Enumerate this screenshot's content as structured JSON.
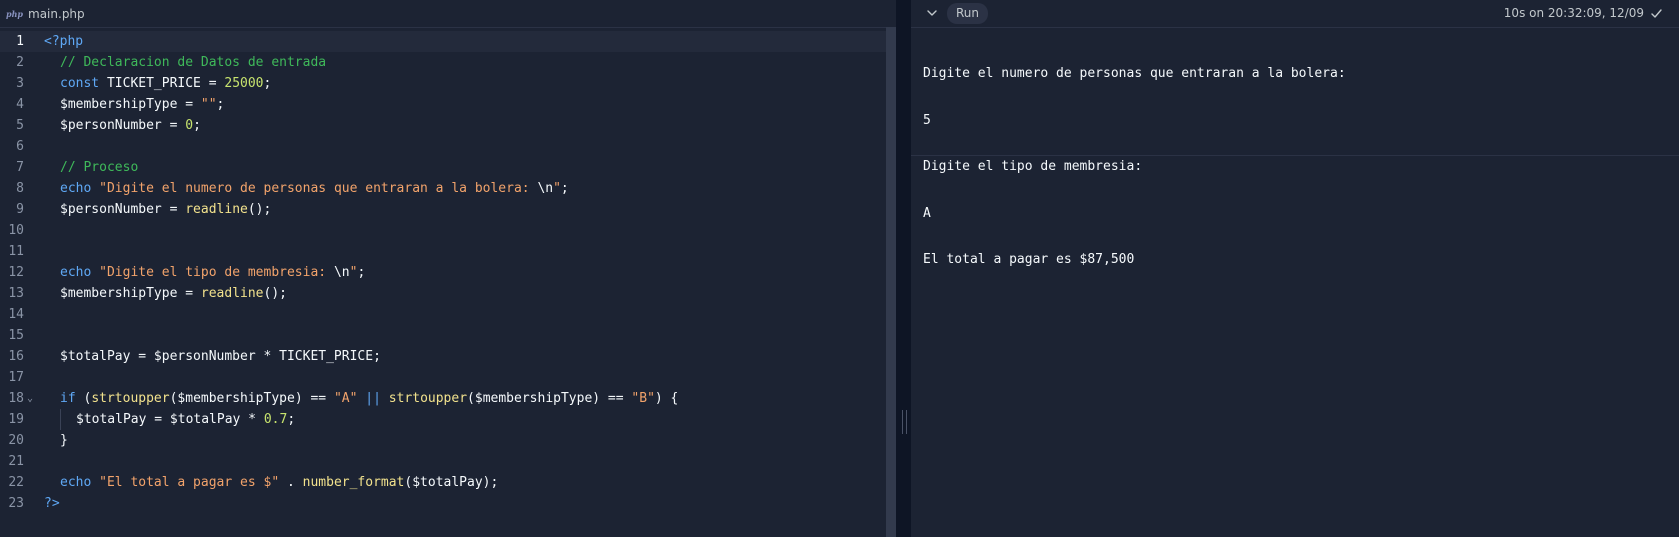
{
  "editor": {
    "file_icon": "php",
    "file_name": "main.php",
    "lines": [
      {
        "n": "1"
      },
      {
        "n": "2"
      },
      {
        "n": "3"
      },
      {
        "n": "4"
      },
      {
        "n": "5"
      },
      {
        "n": "6"
      },
      {
        "n": "7"
      },
      {
        "n": "8"
      },
      {
        "n": "9"
      },
      {
        "n": "10"
      },
      {
        "n": "11"
      },
      {
        "n": "12"
      },
      {
        "n": "13"
      },
      {
        "n": "14"
      },
      {
        "n": "15"
      },
      {
        "n": "16"
      },
      {
        "n": "17"
      },
      {
        "n": "18"
      },
      {
        "n": "19"
      },
      {
        "n": "20"
      },
      {
        "n": "21"
      },
      {
        "n": "22"
      },
      {
        "n": "23"
      }
    ],
    "code": {
      "l1": {
        "open_tag": "<?php"
      },
      "l2": {
        "comment": "// Declaracion de Datos de entrada"
      },
      "l3": {
        "kw": "const",
        "name": " TICKET_PRICE = ",
        "num": "25000",
        "end": ";"
      },
      "l4": {
        "var": "$membershipType = ",
        "str": "\"\"",
        "end": ";"
      },
      "l5": {
        "var": "$personNumber = ",
        "num": "0",
        "end": ";"
      },
      "l7": {
        "comment": "// Proceso"
      },
      "l8": {
        "kw": "echo",
        "str": " \"Digite el numero de personas que entraran a la bolera: ",
        "esc": "\\n",
        "str_end": "\"",
        "end": ";"
      },
      "l9": {
        "var": "$personNumber = ",
        "fn": "readline",
        "end": "();"
      },
      "l12": {
        "kw": "echo",
        "str": " \"Digite el tipo de membresia: ",
        "esc": "\\n",
        "str_end": "\"",
        "end": ";"
      },
      "l13": {
        "var": "$membershipType = ",
        "fn": "readline",
        "end": "();"
      },
      "l16": {
        "text": "$totalPay = $personNumber * TICKET_PRICE;"
      },
      "l18": {
        "kw": "if",
        "p1": " (",
        "fn1": "strtoupper",
        "a1": "($membershipType) == ",
        "s1": "\"A\"",
        "or": " || ",
        "fn2": "strtoupper",
        "a2": "($membershipType) == ",
        "s2": "\"B\"",
        "end": ") {"
      },
      "l19": {
        "text": "$totalPay = $totalPay * ",
        "num": "0.7",
        "end": ";"
      },
      "l20": {
        "text": "}"
      },
      "l22": {
        "kw": "echo",
        "str": " \"El total a pagar es $\"",
        "mid": " . ",
        "fn": "number_format",
        "end": "($totalPay);"
      },
      "l23": {
        "close_tag": "?>"
      }
    }
  },
  "console": {
    "run_label": "Run",
    "status": "10s on 20:32:09, 12/09",
    "output": [
      "Digite el numero de personas que entraran a la bolera:",
      "5",
      "Digite el tipo de membresia:",
      "A",
      "El total a pagar es $87,500"
    ]
  },
  "colors": {
    "background": "#1c2333",
    "keyword": "#5fa8f5",
    "string": "#f2a36b",
    "comment": "#3fb95a",
    "number": "#c7e36e",
    "function": "#f2e28d"
  },
  "icons": {
    "collapse": "chevron-down-icon",
    "status": "check-icon"
  }
}
